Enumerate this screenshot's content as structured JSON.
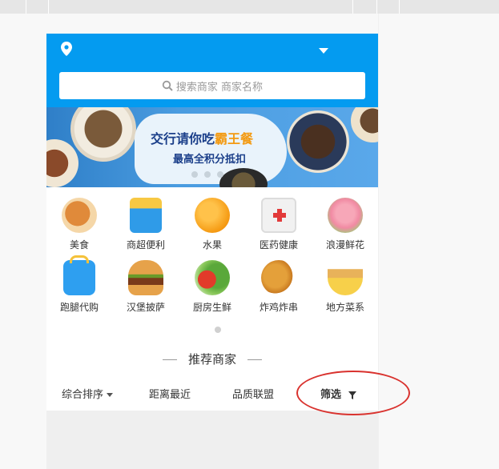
{
  "header": {
    "search_placeholder": "搜索商家 商家名称"
  },
  "banner": {
    "title_prefix": "交行请你吃",
    "title_highlight": "霸王餐",
    "subtitle": "最高全积分抵扣"
  },
  "categories": [
    {
      "label": "美食",
      "icon": "fried-chicken-icon"
    },
    {
      "label": "商超便利",
      "icon": "supermarket-basket-icon"
    },
    {
      "label": "水果",
      "icon": "orange-icon"
    },
    {
      "label": "医药健康",
      "icon": "medicine-box-icon"
    },
    {
      "label": "浪漫鲜花",
      "icon": "rose-icon"
    },
    {
      "label": "跑腿代购",
      "icon": "errand-bag-icon"
    },
    {
      "label": "汉堡披萨",
      "icon": "burger-icon"
    },
    {
      "label": "厨房生鲜",
      "icon": "vegetables-icon"
    },
    {
      "label": "炸鸡炸串",
      "icon": "fried-chicken-leg-icon"
    },
    {
      "label": "地方菜系",
      "icon": "noodle-bowl-icon"
    }
  ],
  "section": {
    "title": "推荐商家"
  },
  "filters": {
    "sort": "综合排序",
    "distance": "距离最近",
    "quality": "品质联盟",
    "filter": "筛选"
  },
  "colors": {
    "brand_blue": "#049bf0",
    "annotation_red": "#d9322e",
    "highlight_orange": "#f39a12"
  }
}
